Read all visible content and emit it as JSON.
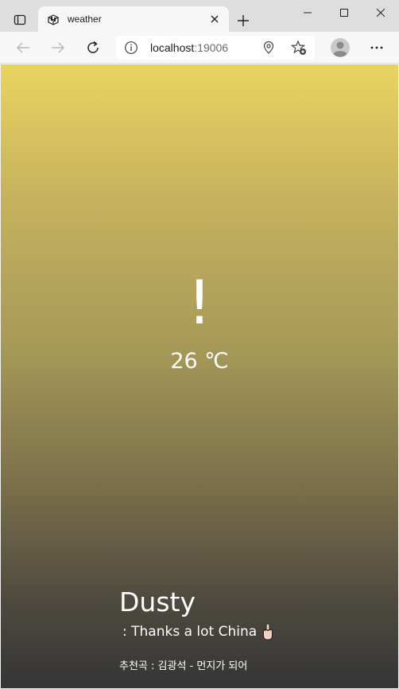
{
  "browser": {
    "tab_title": "weather",
    "url_host": "localhost",
    "url_port": ":19006"
  },
  "weather": {
    "icon_glyph": "!",
    "temperature": "26 ℃",
    "condition": "Dusty",
    "message": ": Thanks a lot China",
    "recommendation": "추천곡 : 김광석 - 먼지가 되어"
  },
  "colors": {
    "gradient_top": "#e9d460",
    "gradient_bottom": "#353535",
    "text": "#ffffff"
  }
}
